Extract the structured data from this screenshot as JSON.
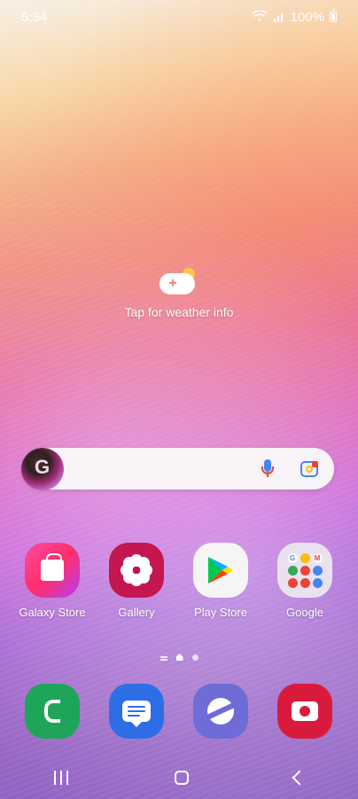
{
  "statusbar": {
    "time": "5:34",
    "battery_text": "100%",
    "icons": [
      "wifi-icon",
      "signal-icon",
      "battery-icon"
    ]
  },
  "weather": {
    "label": "Tap for weather info",
    "icon": "weather-add-icon"
  },
  "search": {
    "icons": [
      "google-avatar-icon",
      "mic-icon",
      "google-lens-icon"
    ]
  },
  "apps": [
    {
      "label": "Galaxy Store",
      "icon": "galaxy-store-icon"
    },
    {
      "label": "Gallery",
      "icon": "gallery-icon"
    },
    {
      "label": "Play Store",
      "icon": "play-store-icon"
    },
    {
      "label": "Google",
      "icon": "google-folder-icon"
    }
  ],
  "dock": [
    {
      "icon": "phone-icon"
    },
    {
      "icon": "messages-icon"
    },
    {
      "icon": "internet-icon"
    },
    {
      "icon": "camera-icon"
    }
  ],
  "navbar": {
    "icons": [
      "recent-apps-icon",
      "home-icon",
      "back-icon"
    ]
  }
}
